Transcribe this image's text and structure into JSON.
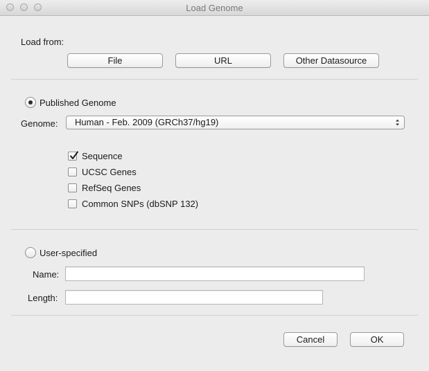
{
  "window": {
    "title": "Load Genome"
  },
  "load_from": {
    "label": "Load from:",
    "buttons": {
      "file": "File",
      "url": "URL",
      "other": "Other Datasource"
    }
  },
  "published": {
    "radio_label": "Published Genome",
    "selected": true,
    "genome_label": "Genome:",
    "genome_value": "Human - Feb. 2009 (GRCh37/hg19)",
    "tracks": [
      {
        "label": "Sequence",
        "checked": true
      },
      {
        "label": "UCSC Genes",
        "checked": false
      },
      {
        "label": "RefSeq Genes",
        "checked": false
      },
      {
        "label": "Common SNPs (dbSNP 132)",
        "checked": false
      }
    ]
  },
  "user_specified": {
    "radio_label": "User-specified",
    "selected": false,
    "name_label": "Name:",
    "name_value": "",
    "length_label": "Length:",
    "length_value": ""
  },
  "footer": {
    "cancel": "Cancel",
    "ok": "OK"
  },
  "colors": {
    "background": "#ececec",
    "title_text": "#7a7a7a"
  }
}
